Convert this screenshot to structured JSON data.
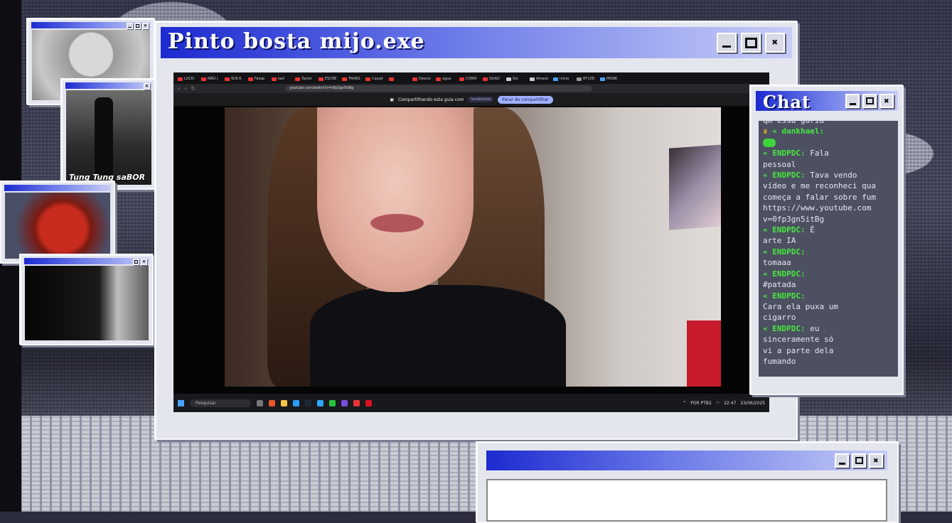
{
  "main_window": {
    "title": "Pinto bosta mijo.exe",
    "browser": {
      "tabs": [
        "LUCK!",
        "NÃO (",
        "W.B.R.",
        "Fazap",
        "lael",
        "Taylor",
        "ESCRE",
        "TRANS",
        "Caçad",
        "Desviv",
        "agua",
        "COMO",
        "QUAD",
        "Sol",
        "Amazo",
        "Início",
        "BT(28)",
        "MONK"
      ],
      "url": "youtube.com/watch?v=0fp3gn5itBg",
      "share_text": "Compartilhando esta guia com",
      "share_target": "tenebrante",
      "stop_share_label": "Parar de compartilhar",
      "taskbar": {
        "search_placeholder": "Pesquisar",
        "lang": "POR PTB2",
        "time": "22:47",
        "date": "23/06/2025"
      }
    }
  },
  "chat_window": {
    "title": "Chat",
    "lines": [
      {
        "user": "",
        "text": "qm essa guria"
      },
      {
        "crown": true,
        "user": "dankhael:",
        "text": ""
      },
      {
        "emote": "green-emote",
        "user": "",
        "text": ""
      },
      {
        "user": "ENDPDC:",
        "text": "Fala"
      },
      {
        "user": "",
        "text": "pessoal"
      },
      {
        "user": "ENDPDC:",
        "text": "Tava vendo"
      },
      {
        "user": "",
        "text": "vídeo e me reconheci qua"
      },
      {
        "user": "",
        "text": "começa a falar sobre fum"
      },
      {
        "user": "",
        "text": "https://www.youtube.com"
      },
      {
        "user": "",
        "text": "v=0fp3gn5itBg"
      },
      {
        "user": "ENDPDC:",
        "text": "É"
      },
      {
        "user": "",
        "text": "arte IA"
      },
      {
        "user": "ENDPDC:",
        "text": ""
      },
      {
        "user": "",
        "text": "tomaaa"
      },
      {
        "user": "ENDPDC:",
        "text": ""
      },
      {
        "user": "",
        "text": "#patada"
      },
      {
        "user": "ENDPDC:",
        "text": ""
      },
      {
        "user": "",
        "text": "Cara ela puxa um"
      },
      {
        "user": "",
        "text": "cigarro"
      },
      {
        "user": "ENDPDC:",
        "text": "eu"
      },
      {
        "user": "",
        "text": "sinceramente só"
      },
      {
        "user": "",
        "text": "vi a parte dela"
      },
      {
        "user": "",
        "text": "fumando"
      }
    ]
  },
  "small_windows": {
    "w2_caption": "Tung Tung saBOR"
  },
  "colors": {
    "titlebar_start": "#1c2ad0",
    "titlebar_end": "#c7cdf7",
    "chat_username": "#46e83e",
    "chat_bg": "#4c5061"
  }
}
